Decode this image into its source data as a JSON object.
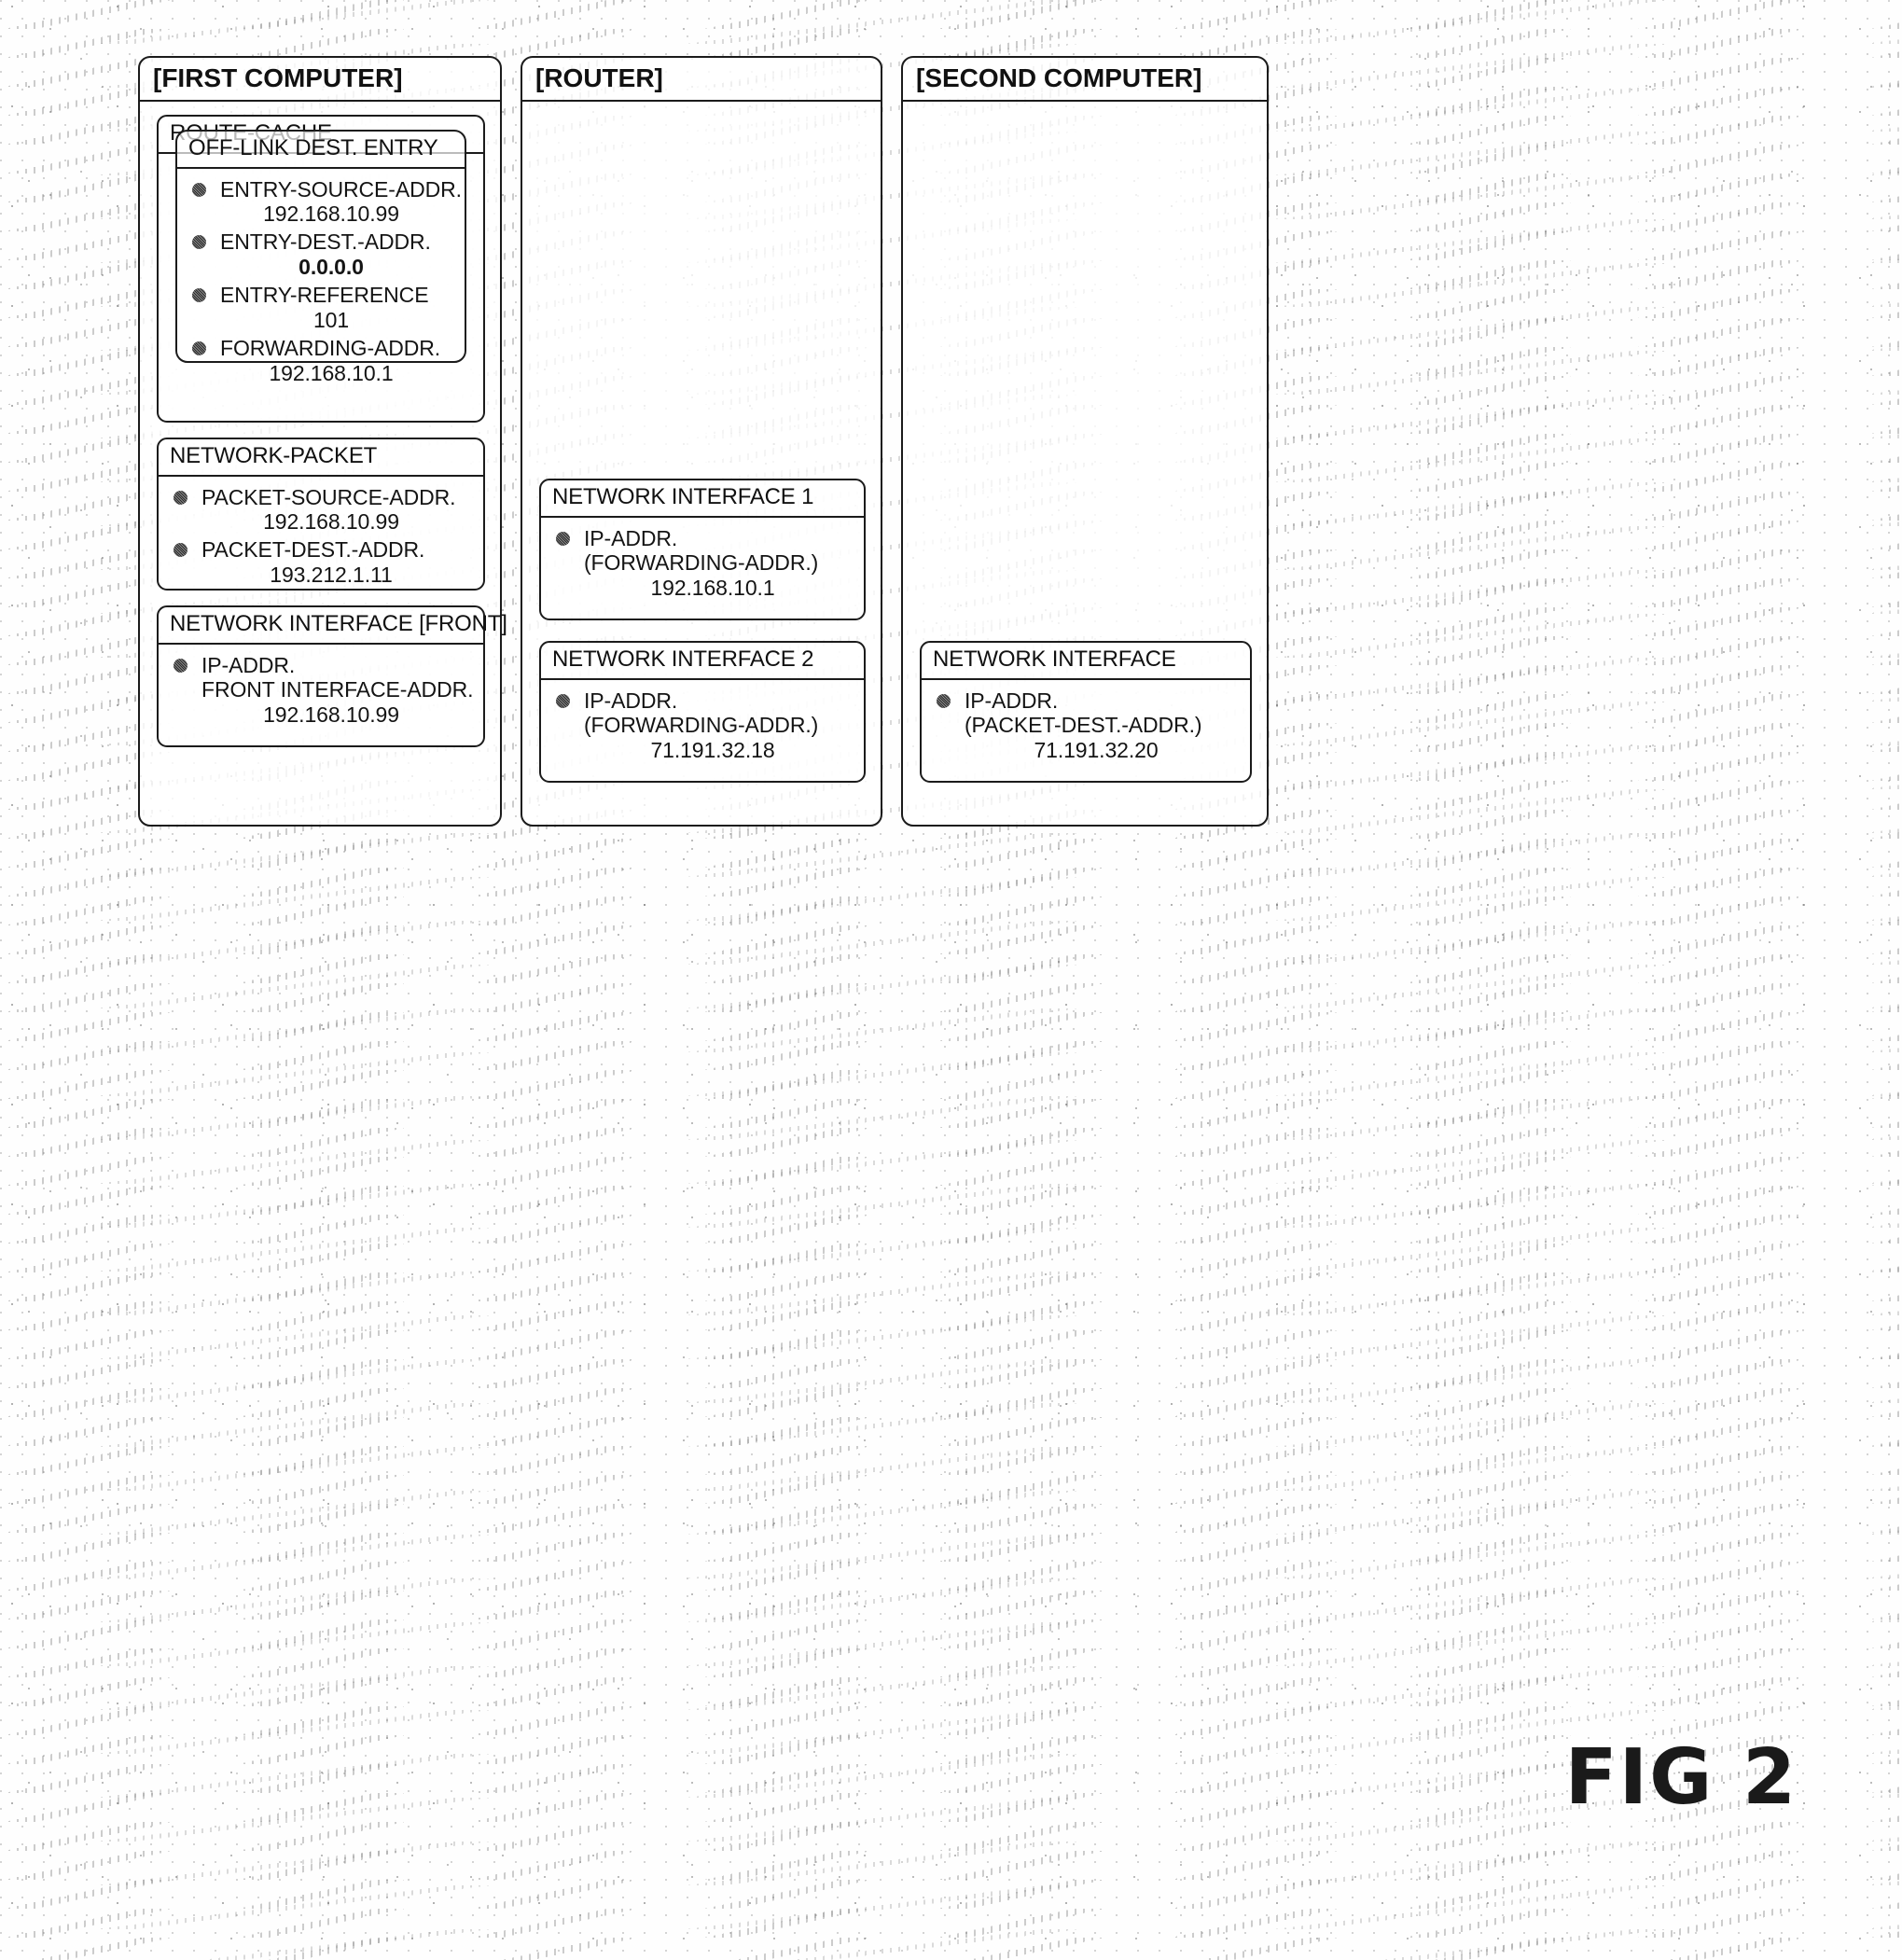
{
  "figure": {
    "label": "FIG 2"
  },
  "columns": [
    {
      "id": "first-computer",
      "title": "[FIRST COMPUTER]",
      "cards": [
        {
          "id": "route-cache",
          "title": "ROUTE-CACHE",
          "inner": {
            "id": "off-link-dest-entry",
            "title": "OFF-LINK DEST. ENTRY",
            "attrs": [
              {
                "label": "ENTRY-SOURCE-ADDR.",
                "value": "192.168.10.99",
                "bold": false
              },
              {
                "label": "ENTRY-DEST.-ADDR.",
                "value": "0.0.0.0",
                "bold": true
              },
              {
                "label": "ENTRY-REFERENCE",
                "value": "101",
                "bold": false
              },
              {
                "label": "FORWARDING-ADDR.",
                "value": "192.168.10.1",
                "bold": false
              }
            ]
          }
        },
        {
          "id": "network-packet",
          "title": "NETWORK-PACKET",
          "attrs": [
            {
              "label": "PACKET-SOURCE-ADDR.",
              "value": "192.168.10.99"
            },
            {
              "label": "PACKET-DEST.-ADDR.",
              "value": "193.212.1.11"
            }
          ]
        },
        {
          "id": "network-interface-front",
          "title": "NETWORK INTERFACE [FRONT]",
          "attrs": [
            {
              "label": "IP-ADDR.",
              "sub": "FRONT INTERFACE-ADDR.",
              "value": "192.168.10.99"
            }
          ]
        }
      ]
    },
    {
      "id": "router",
      "title": "[ROUTER]",
      "cards": [
        {
          "id": "network-interface-1",
          "title": "NETWORK INTERFACE 1",
          "attrs": [
            {
              "label": "IP-ADDR.",
              "sub": "(FORWARDING-ADDR.)",
              "value": "192.168.10.1"
            }
          ]
        },
        {
          "id": "network-interface-2",
          "title": "NETWORK INTERFACE 2",
          "attrs": [
            {
              "label": "IP-ADDR.",
              "sub": "(FORWARDING-ADDR.)",
              "value": "71.191.32.18"
            }
          ]
        }
      ]
    },
    {
      "id": "second-computer",
      "title": "[SECOND COMPUTER]",
      "cards": [
        {
          "id": "network-interface",
          "title": "NETWORK INTERFACE",
          "attrs": [
            {
              "label": "IP-ADDR.",
              "sub": "(PACKET-DEST.-ADDR.)",
              "value": "71.191.32.20"
            }
          ]
        }
      ]
    }
  ]
}
